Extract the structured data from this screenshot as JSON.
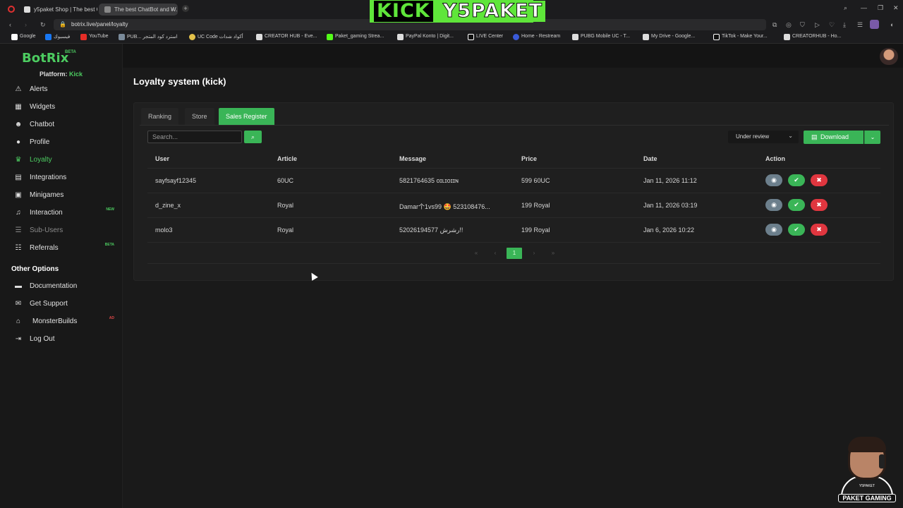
{
  "browser": {
    "tabs": [
      {
        "title": "y5paket Shop | The best C"
      },
      {
        "title": "The best ChatBot and W..."
      }
    ],
    "new_tab": "+",
    "url": "botrix.live/panel/loyalty",
    "bookmarks": [
      "Google",
      "فيسبوك",
      "YouTube",
      "PUB... استرد كود المتجر",
      "UC Code أكواد شدات",
      "CREATOR HUB - Eve...",
      "Paket_gaming Strea...",
      "PayPal Konto | Digit...",
      "LIVE Center",
      "Home - Restream",
      "PUBG Mobile UC - T...",
      "My Drive - Google...",
      "TikTok - Make Your...",
      "CREATORHUB - Ho..."
    ],
    "icons": {
      "back": "chevron-left-icon",
      "reload": "reload-icon",
      "lock": "lock-icon"
    }
  },
  "banner": {
    "left": "KICK",
    "right": "Y5PAKET"
  },
  "sidebar": {
    "logo": "BotRix",
    "logo_badge": "BETA",
    "platform_label": "Platform:",
    "platform_value": "Kick",
    "items": [
      {
        "label": "Alerts",
        "icon": "⚠"
      },
      {
        "label": "Widgets",
        "icon": "▦"
      },
      {
        "label": "Chatbot",
        "icon": "☻"
      },
      {
        "label": "Profile",
        "icon": "●"
      },
      {
        "label": "Loyalty",
        "icon": "♛"
      },
      {
        "label": "Integrations",
        "icon": "▤"
      },
      {
        "label": "Minigames",
        "icon": "▣"
      },
      {
        "label": "Interaction",
        "icon": "♫",
        "tag": "NEW"
      },
      {
        "label": "Sub-Users",
        "icon": "☰"
      },
      {
        "label": "Referrals",
        "icon": "☷",
        "tag": "BETA"
      }
    ],
    "other_heading": "Other Options",
    "other_items": [
      {
        "label": "Documentation",
        "icon": "▬"
      },
      {
        "label": "Get Support",
        "icon": "✉"
      },
      {
        "label": "MonsterBuilds",
        "icon": "⌂",
        "tag": "AD"
      },
      {
        "label": "Log Out",
        "icon": "⇥"
      }
    ]
  },
  "main": {
    "title": "Loyalty system (kick)",
    "tabs": [
      "Ranking",
      "Store",
      "Sales Register"
    ],
    "search_placeholder": "Search...",
    "status_filter": "Under review",
    "download_label": "Download",
    "columns": [
      "User",
      "Article",
      "Message",
      "Price",
      "Date",
      "Action"
    ],
    "rows": [
      {
        "user": "sayfsayf12345",
        "article": "60UC",
        "message": "5821764635 ᴏɪʟɪᴏɪɪɴ",
        "price": "599 60UC",
        "date": "Jan 11, 2026 11:12"
      },
      {
        "user": "d_zine_x",
        "article": "Royal",
        "message": "Damar个1vs99 🤩 523108476...",
        "price": "199 Royal",
        "date": "Jan 11, 2026 03:19"
      },
      {
        "user": "molo3",
        "article": "Royal",
        "message": "52026194577 رشرش!!",
        "price": "199 Royal",
        "date": "Jan 6, 2026 10:22"
      }
    ],
    "pagination": {
      "first": "«",
      "prev": "‹",
      "current": "1",
      "next": "›",
      "last": "»"
    }
  },
  "overlay": {
    "streamer_label": "PAKET GAMING",
    "streamer_tag": "Y5PAKET"
  }
}
